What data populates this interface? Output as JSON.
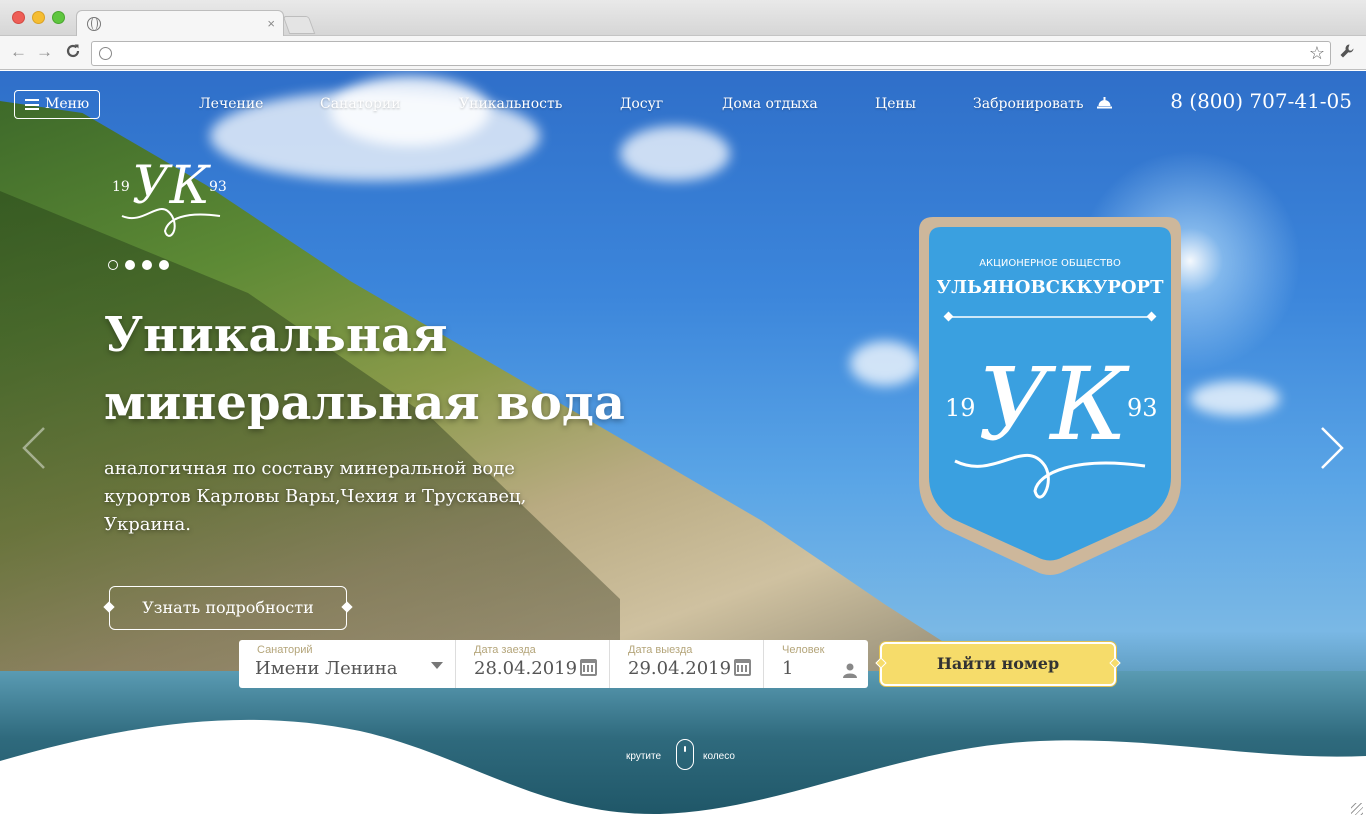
{
  "browser": {
    "tab_close": "×",
    "back_glyph": "←",
    "forward_glyph": "→",
    "reload_glyph": "C",
    "star_glyph": "☆",
    "wrench_glyph": "🔧",
    "url": ""
  },
  "header": {
    "menu_label": "Меню",
    "nav": [
      "Лечение",
      "Санатории",
      "Уникальность",
      "Досуг",
      "Дома отдыха",
      "Цены",
      "Забронировать"
    ],
    "phone": "8 (800) 707-41-05"
  },
  "logo": {
    "year_left": "19",
    "monogram": "УК",
    "year_right": "93"
  },
  "hero": {
    "title_lines": [
      "Уникальная",
      "минеральная вода"
    ],
    "subtitle_lines": [
      "аналогичная по составу минеральной воде",
      "курортов Карловы Вары,Чехия и Трускавец,",
      "Украина."
    ],
    "more_button": "Узнать подробности",
    "slides_total": 4,
    "active_slide": 1
  },
  "emblem": {
    "org_type": "АКЦИОНЕРНОЕ ОБЩЕСТВО",
    "org_name": "УЛЬЯНОВСККУРОРТ",
    "year_left": "19",
    "monogram": "УК",
    "year_right": "93"
  },
  "booking": {
    "sanatorium_label": "Санаторий",
    "sanatorium_value": "Имени Ленина",
    "checkin_label": "Дата заезда",
    "checkin_value": "28.04.2019",
    "checkout_label": "Дата выезда",
    "checkout_value": "29.04.2019",
    "guests_label": "Человек",
    "guests_value": "1",
    "find_button": "Найти номер"
  },
  "scroll_hint": {
    "left": "крутите",
    "right": "колесо"
  },
  "colors": {
    "accent_gold": "#f6dc6a",
    "label_gold": "#b4a57a",
    "emblem_blue": "#3aa0e0"
  }
}
